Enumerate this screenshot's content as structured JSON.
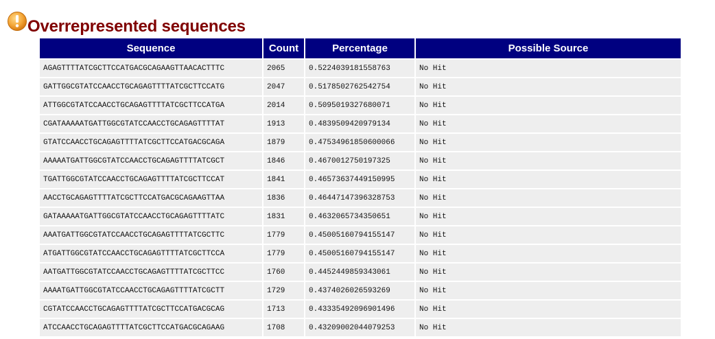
{
  "header": {
    "icon": "warning-icon",
    "icon_color": "#f0a030",
    "title": "Overrepresented sequences",
    "title_color": "#800000"
  },
  "table": {
    "header_bg": "#000080",
    "row_bg": "#eeeeee",
    "columns": [
      "Sequence",
      "Count",
      "Percentage",
      "Possible Source"
    ],
    "rows": [
      [
        "AGAGTTTTATCGCTTCCATGACGCAGAAGTTAACACTTTC",
        "2065",
        "0.5224039181558763",
        "No Hit"
      ],
      [
        "GATTGGCGTATCCAACCTGCAGAGTTTTATCGCTTCCATG",
        "2047",
        "0.5178502762542754",
        "No Hit"
      ],
      [
        "ATTGGCGTATCCAACCTGCAGAGTTTTATCGCTTCCATGA",
        "2014",
        "0.5095019327680071",
        "No Hit"
      ],
      [
        "CGATAAAAATGATTGGCGTATCCAACCTGCAGAGTTTTAT",
        "1913",
        "0.4839509420979134",
        "No Hit"
      ],
      [
        "GTATCCAACCTGCAGAGTTTTATCGCTTCCATGACGCAGA",
        "1879",
        "0.47534961850600066",
        "No Hit"
      ],
      [
        "AAAAATGATTGGCGTATCCAACCTGCAGAGTTTTATCGCT",
        "1846",
        "0.4670012750197325",
        "No Hit"
      ],
      [
        "TGATTGGCGTATCCAACCTGCAGAGTTTTATCGCTTCCAT",
        "1841",
        "0.46573637449150995",
        "No Hit"
      ],
      [
        "AACCTGCAGAGTTTTATCGCTTCCATGACGCAGAAGTTAA",
        "1836",
        "0.46447147396328753",
        "No Hit"
      ],
      [
        "GATAAAAATGATTGGCGTATCCAACCTGCAGAGTTTTATC",
        "1831",
        "0.4632065734350651",
        "No Hit"
      ],
      [
        "AAATGATTGGCGTATCCAACCTGCAGAGTTTTATCGCTTC",
        "1779",
        "0.45005160794155147",
        "No Hit"
      ],
      [
        "ATGATTGGCGTATCCAACCTGCAGAGTTTTATCGCTTCCA",
        "1779",
        "0.45005160794155147",
        "No Hit"
      ],
      [
        "AATGATTGGCGTATCCAACCTGCAGAGTTTTATCGCTTCC",
        "1760",
        "0.4452449859343061",
        "No Hit"
      ],
      [
        "AAAATGATTGGCGTATCCAACCTGCAGAGTTTTATCGCTT",
        "1729",
        "0.4374026026593269",
        "No Hit"
      ],
      [
        "CGTATCCAACCTGCAGAGTTTTATCGCTTCCATGACGCAG",
        "1713",
        "0.43335492096901496",
        "No Hit"
      ],
      [
        "ATCCAACCTGCAGAGTTTTATCGCTTCCATGACGCAGAAG",
        "1708",
        "0.43209002044079253",
        "No Hit"
      ]
    ]
  }
}
